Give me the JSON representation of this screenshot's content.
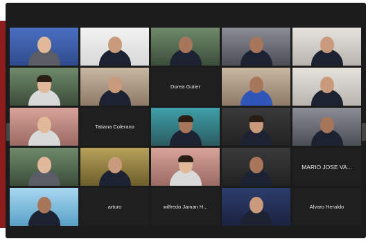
{
  "meeting": {
    "participants": [
      {
        "id": "p1",
        "type": "video"
      },
      {
        "id": "p2",
        "type": "video"
      },
      {
        "id": "p3",
        "type": "video"
      },
      {
        "id": "p4",
        "type": "video"
      },
      {
        "id": "p5",
        "type": "video"
      },
      {
        "id": "p6",
        "type": "video"
      },
      {
        "id": "p7",
        "type": "video"
      },
      {
        "id": "p8",
        "type": "name",
        "name": "Dorea Gutier"
      },
      {
        "id": "p9",
        "type": "video"
      },
      {
        "id": "p10",
        "type": "video"
      },
      {
        "id": "p11",
        "type": "video"
      },
      {
        "id": "p12",
        "type": "name",
        "name": "Tatiana Colerano"
      },
      {
        "id": "p13",
        "type": "video"
      },
      {
        "id": "p14",
        "type": "video"
      },
      {
        "id": "p15",
        "type": "video"
      },
      {
        "id": "p16",
        "type": "video"
      },
      {
        "id": "p17",
        "type": "video"
      },
      {
        "id": "p18",
        "type": "video"
      },
      {
        "id": "p19",
        "type": "video"
      },
      {
        "id": "p20",
        "type": "name",
        "name": "MARIO JOSE VA..."
      },
      {
        "id": "p21",
        "type": "video"
      },
      {
        "id": "p22",
        "type": "name",
        "name": "arturo"
      },
      {
        "id": "p23",
        "type": "name",
        "name": "wilfredo Jaman H..."
      },
      {
        "id": "p24",
        "type": "video"
      },
      {
        "id": "p25",
        "type": "name",
        "name": "Alvaro Heraldo"
      }
    ]
  }
}
